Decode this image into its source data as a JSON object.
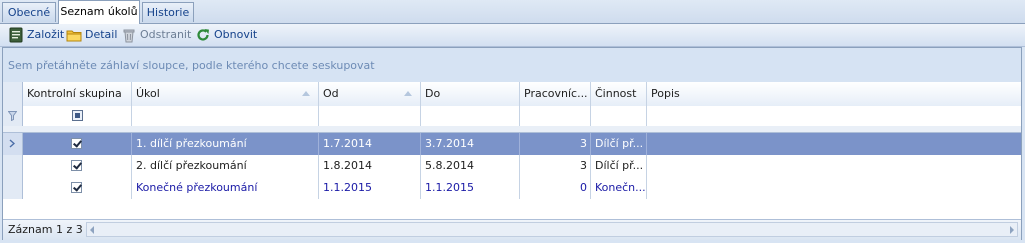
{
  "tabs": [
    {
      "label": "Obecné",
      "active": false
    },
    {
      "label": "Seznam úkolů",
      "active": true
    },
    {
      "label": "Historie",
      "active": false
    }
  ],
  "toolbar": {
    "create_label": "Založit",
    "detail_label": "Detail",
    "delete_label": "Odstranit",
    "refresh_label": "Obnovit"
  },
  "grid": {
    "group_hint": "Sem přetáhněte záhlaví sloupce, podle kterého chcete seskupovat",
    "columns": [
      "Kontrolní skupina",
      "Úkol",
      "Od",
      "Do",
      "Pracovníc...",
      "Činnost",
      "Popis"
    ],
    "rows": [
      {
        "checked": true,
        "ukol": "1. dílčí přezkoumání",
        "od": "1.7.2014",
        "do": "3.7.2014",
        "pracovnici": "3",
        "cinnost": "Dílčí př...",
        "popis": ""
      },
      {
        "checked": true,
        "ukol": "2. dílčí přezkoumání",
        "od": "1.8.2014",
        "do": "5.8.2014",
        "pracovnici": "3",
        "cinnost": "Dílčí př...",
        "popis": ""
      },
      {
        "checked": true,
        "ukol": "Konečné přezkoumání",
        "od": "1.1.2015",
        "do": "1.1.2015",
        "pracovnici": "0",
        "cinnost": "Konečn...",
        "popis": ""
      }
    ],
    "record_status": "Záznam 1 z 3"
  },
  "colors": {
    "selected_row": "#7b93c9",
    "link_text": "#1a1aa6",
    "toolbar_text": "#15428b"
  }
}
